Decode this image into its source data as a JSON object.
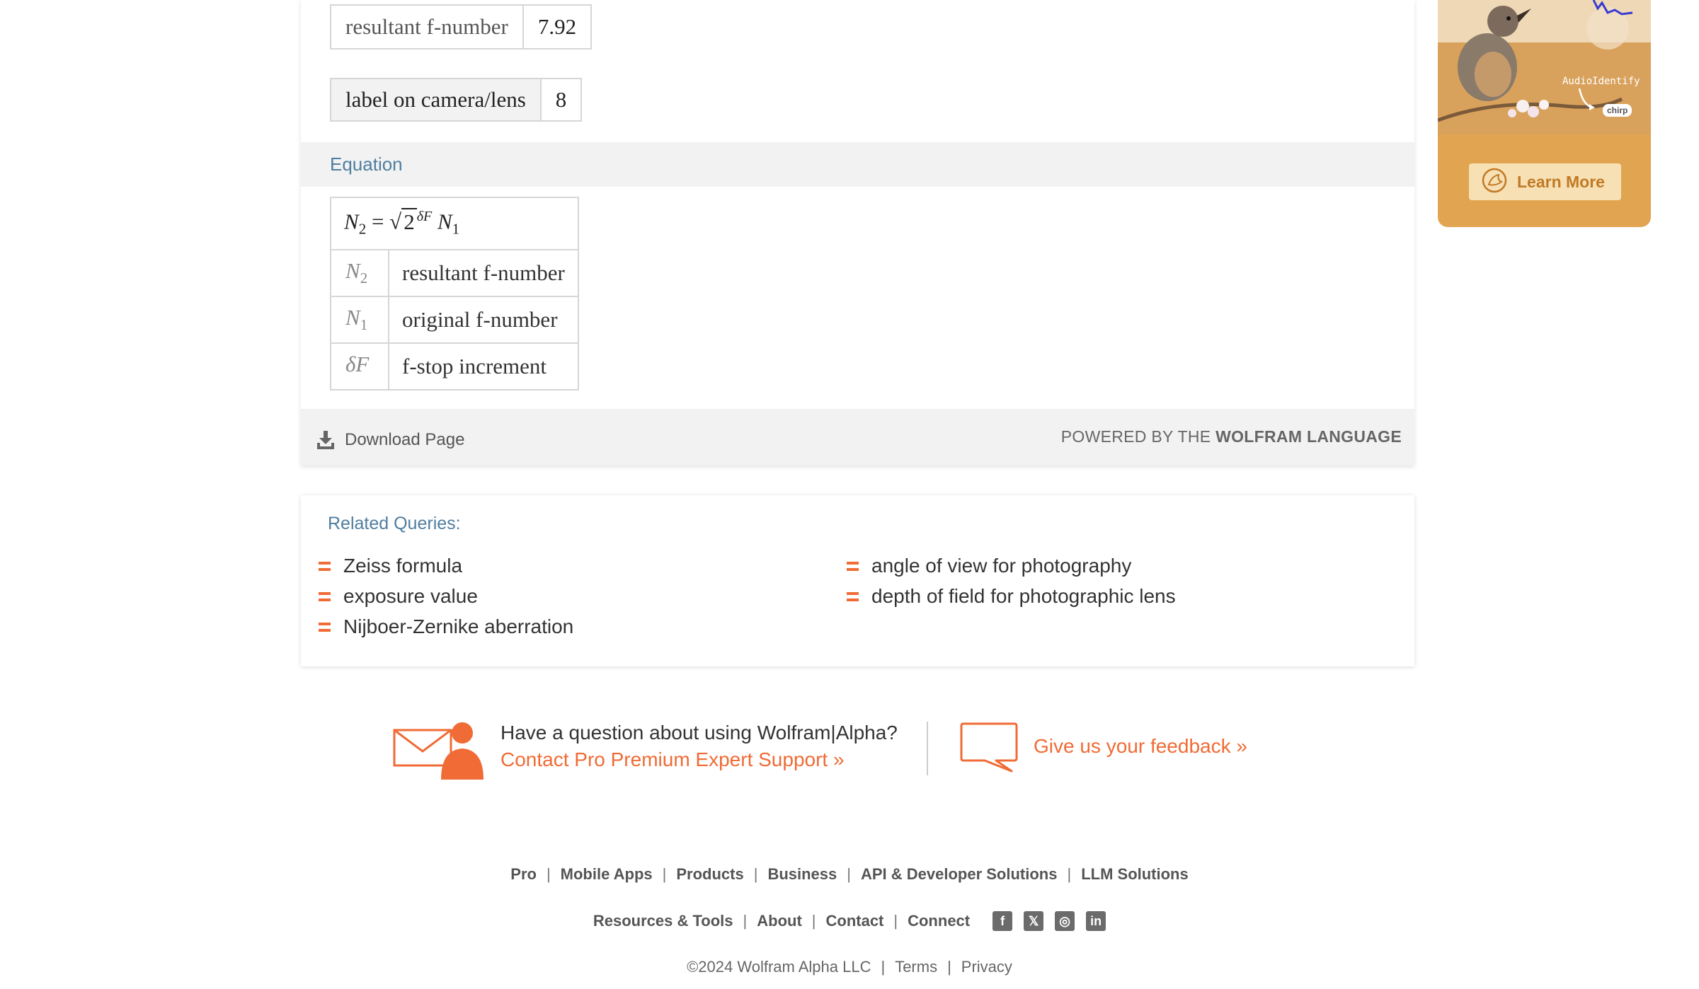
{
  "result": {
    "resultant_label": "resultant f-number",
    "resultant_value": "7.92",
    "camera_label": "label on camera/lens",
    "camera_value": "8",
    "equation_title": "Equation",
    "equation": {
      "lhs_symbol": "N",
      "lhs_sub": "2",
      "equals": "=",
      "radicand": "2",
      "exponent": "δF",
      "rhs_symbol": "N",
      "rhs_sub": "1"
    },
    "variables": [
      {
        "symbol": "N",
        "sub": "2",
        "description": "resultant f-number"
      },
      {
        "symbol": "N",
        "sub": "1",
        "description": "original f-number"
      },
      {
        "symbol": "δF",
        "sub": "",
        "description": "f-stop increment"
      }
    ],
    "download_label": "Download Page",
    "powered_prefix": "POWERED BY THE",
    "powered_brand": "WOLFRAM LANGUAGE"
  },
  "related": {
    "title": "Related Queries:",
    "items": [
      "Zeiss formula",
      "exposure value",
      "Nijboer-Zernike aberration",
      "angle of view for photography",
      "depth of field for photographic lens"
    ]
  },
  "support": {
    "question": "Have a question about using Wolfram|Alpha?",
    "contact_link": "Contact Pro Premium Expert Support »",
    "feedback_link": "Give us your feedback »"
  },
  "footer": {
    "row1": [
      "Pro",
      "Mobile Apps",
      "Products",
      "Business",
      "API & Developer Solutions",
      "LLM Solutions"
    ],
    "row2": [
      "Resources & Tools",
      "About",
      "Contact",
      "Connect"
    ],
    "social_icons": [
      "facebook-icon",
      "x-icon",
      "instagram-icon",
      "linkedin-icon"
    ],
    "copyright": "©2024  Wolfram Alpha LLC",
    "terms": "Terms",
    "privacy": "Privacy"
  },
  "ad": {
    "audio_text": "AudioIdentify",
    "chirp_text": "chirp",
    "button_label": "Learn More",
    "colors": {
      "background": "#e1a552",
      "button": "#f7e0b3",
      "button_text": "#c07a26"
    }
  },
  "colors": {
    "accent": "#f06b35",
    "section_title": "#4f7ea0"
  }
}
